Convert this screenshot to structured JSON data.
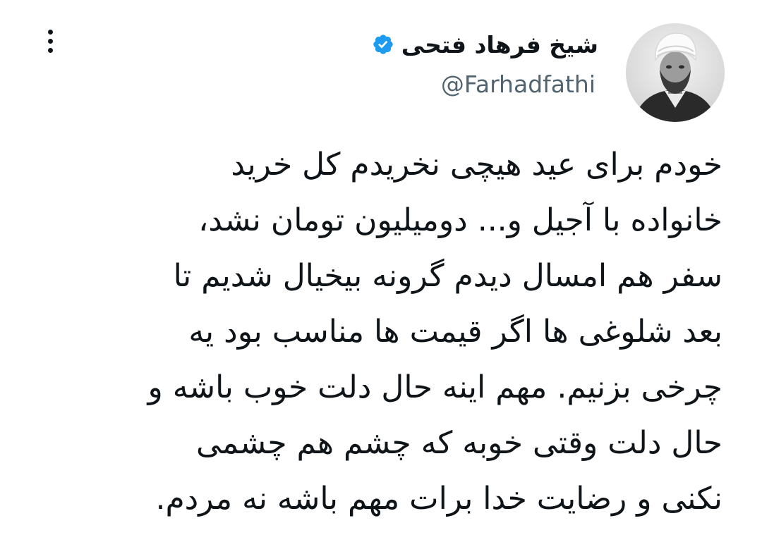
{
  "author": {
    "display_name": "شیخ فرهاد فتحی",
    "handle": "@Farhadfathi",
    "verified": true,
    "verified_color": "#1d9bf0"
  },
  "tweet": {
    "lines": [
      "خودم برای عید هیچی نخریدم کل خرید",
      "خانواده با آجیل و... دومیلیون تومان نشد،",
      "سفر هم امسال دیدم گرونه بیخیال شدیم تا",
      "بعد شلوغی ها اگر قیمت ها مناسب بود یه",
      "چرخی بزنیم. مهم اینه حال دلت خوب باشه و",
      "حال دلت وقتی خوبه که چشم هم چشمی",
      "نکنی و رضایت خدا برات مهم باشه نه مردم."
    ]
  },
  "icons": {
    "verified": "verified-badge-icon",
    "more": "more-options-icon",
    "avatar": "profile-avatar"
  }
}
